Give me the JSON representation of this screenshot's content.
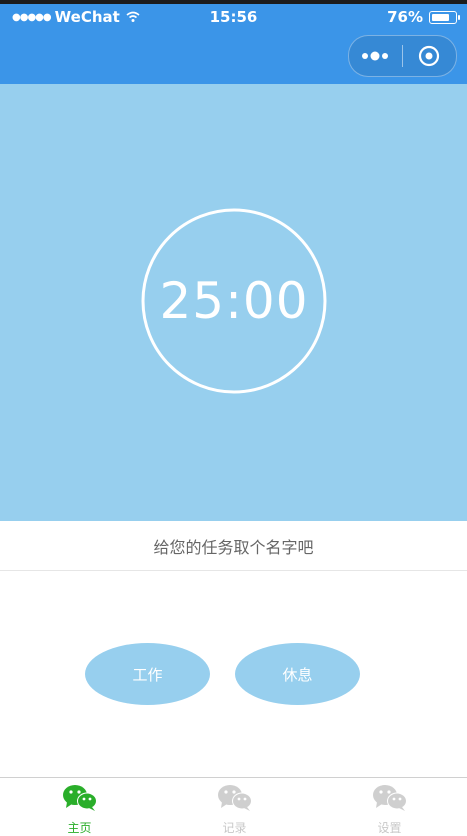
{
  "status_bar": {
    "carrier": "WeChat",
    "time": "15:56",
    "battery_percent": "76%",
    "battery_level": 0.76
  },
  "timer": {
    "display": "25:00"
  },
  "task": {
    "name_placeholder": "给您的任务取个名字吧"
  },
  "buttons": {
    "work": "工作",
    "rest": "休息"
  },
  "tabbar": {
    "items": [
      {
        "label": "主页",
        "icon": "wechat-icon",
        "active": true
      },
      {
        "label": "记录",
        "icon": "wechat-icon",
        "active": false
      },
      {
        "label": "设置",
        "icon": "wechat-icon",
        "active": false
      }
    ]
  },
  "colors": {
    "nav_blue": "#3b95e8",
    "timer_bg": "#97cfee",
    "active_tab": "#2aae2a",
    "inactive_tab": "#c8c8c8"
  }
}
